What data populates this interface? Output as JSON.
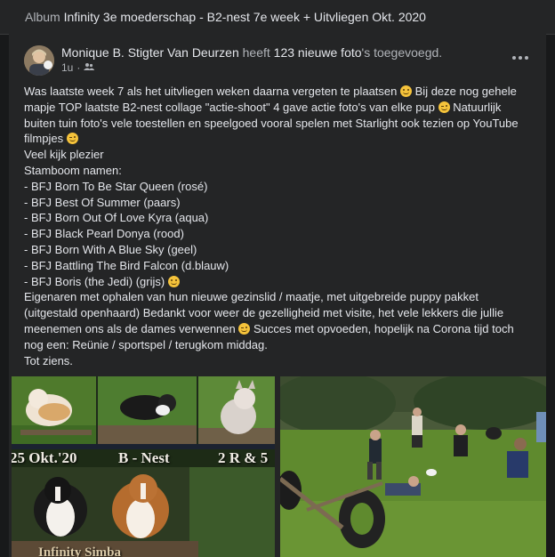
{
  "album": {
    "prefix": "Album",
    "name": "Infinity 3e moederschap - B2-nest 7e week + Uitvliegen Okt. 2020"
  },
  "post": {
    "author": "Monique B. Stigter Van Deurzen",
    "action_pre": "heeft",
    "photo_count": "123 nieuwe foto",
    "action_post": "'s toegevoegd.",
    "time": "1u",
    "audience_icon": "friends-icon",
    "more_icon": "more-options-icon",
    "lines": [
      "Was laatste week 7 als het uitvliegen weken daarna vergeten te plaatsen",
      "Bij deze nog gehele",
      "mapje TOP laatste B2-nest collage \"actie-shoot\" 4 gave actie foto's van elke pup",
      "Natuurlijk",
      "buiten tuin foto's vele toestellen en speelgoed vooral spelen met Starlight ook tezien op YouTube",
      "filmpjes",
      "Veel kijk plezier",
      "Stamboom namen:",
      "- BFJ Born To Be Star Queen (rosé)",
      "- BFJ Best Of Summer (paars)",
      "- BFJ Born Out Of Love Kyra (aqua)",
      "- BFJ Black Pearl Donya (rood)",
      "- BFJ Born With A Blue Sky (geel)",
      "- BFJ Battling The Bird Falcon (d.blauw)",
      "- BFJ Boris (the Jedi) (grijs)",
      "Eigenaren met ophalen van hun nieuwe gezinslid / maatje, met uitgebreide puppy pakket",
      "(uitgestald openhaard) Bedankt voor weer de gezelligheid met visite, het vele lekkers die jullie",
      "meenemen ons als de dames verwennen",
      "Succes met opvoeden, hopelijk na Corona tijd toch",
      "nog een: Reünie / sportspel / terugkom middag.",
      "Tot ziens."
    ]
  },
  "collage": {
    "date": "25 Okt.'20",
    "nest": "B - Nest",
    "count": "2 R & 5",
    "kennel": "Infinity Simba"
  }
}
